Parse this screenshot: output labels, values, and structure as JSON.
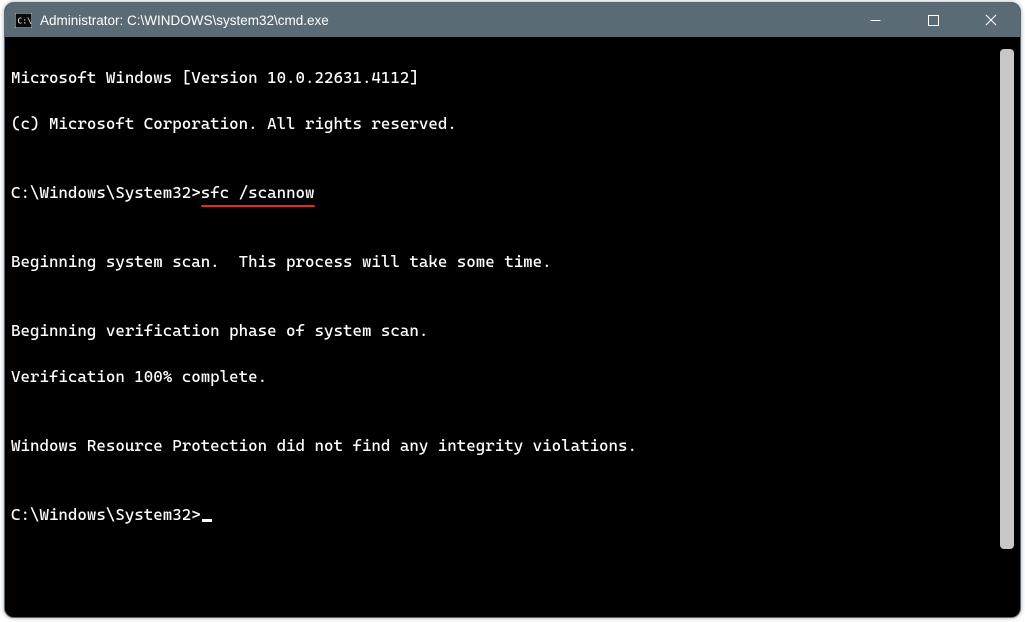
{
  "window": {
    "title": "Administrator: C:\\WINDOWS\\system32\\cmd.exe"
  },
  "terminal": {
    "line1": "Microsoft Windows [Version 10.0.22631.4112]",
    "line2": "(c) Microsoft Corporation. All rights reserved.",
    "blank1": "",
    "prompt1": "C:\\Windows\\System32>",
    "command1": "sfc /scannow",
    "blank2": "",
    "line5": "Beginning system scan.  This process will take some time.",
    "blank3": "",
    "line6": "Beginning verification phase of system scan.",
    "line7": "Verification 100% complete.",
    "blank4": "",
    "line8": "Windows Resource Protection did not find any integrity violations.",
    "blank5": "",
    "prompt2": "C:\\Windows\\System32>"
  },
  "icons": {
    "app": "cmd-icon",
    "minimize": "minimize-icon",
    "maximize": "maximize-icon",
    "close": "close-icon"
  }
}
